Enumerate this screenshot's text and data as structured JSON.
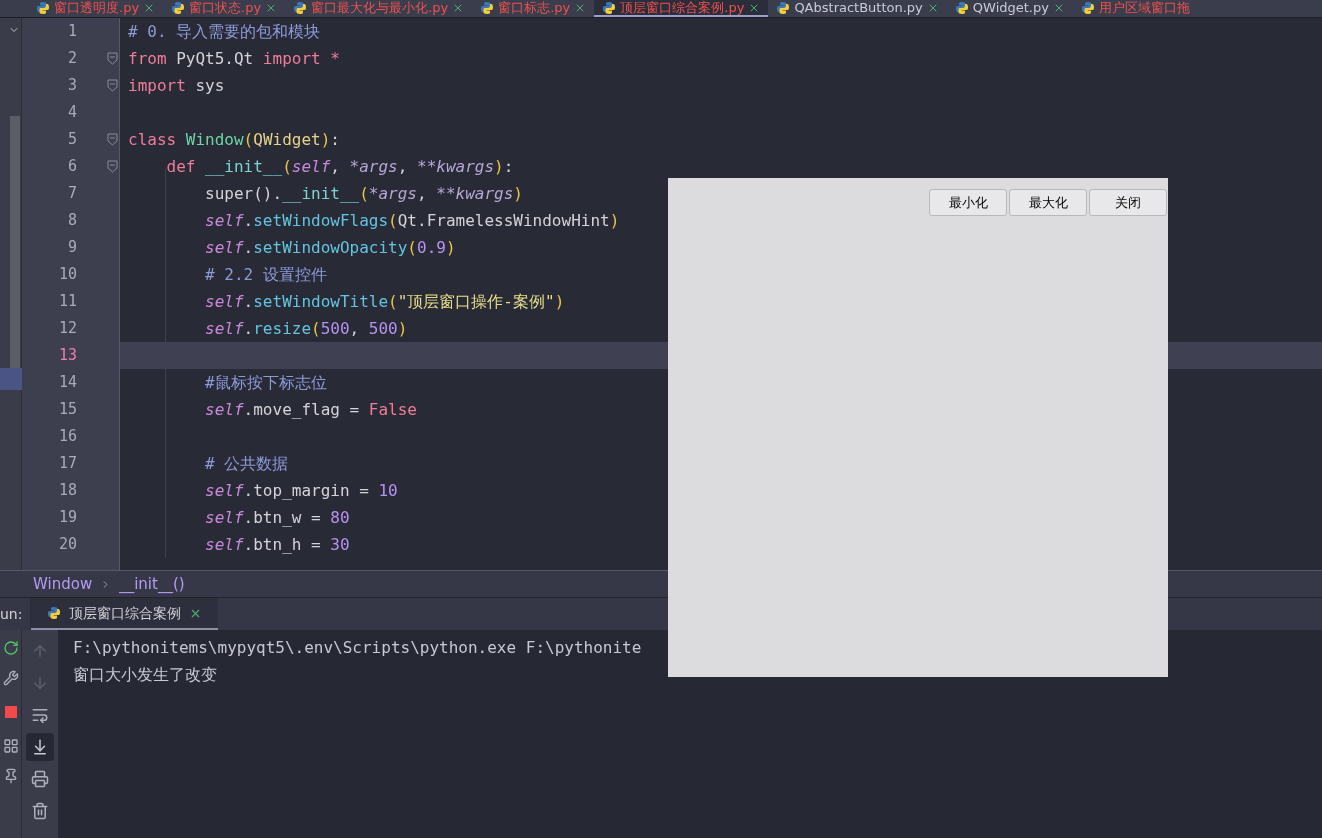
{
  "editor_tabs": [
    {
      "label": "窗口透明度.py",
      "selected": false
    },
    {
      "label": "窗口状态.py",
      "selected": false
    },
    {
      "label": "窗口最大化与最小化.py",
      "selected": false
    },
    {
      "label": "窗口标志.py",
      "selected": false
    },
    {
      "label": "顶层窗口综合案例.py",
      "selected": true
    },
    {
      "label": "QAbstractButton.py",
      "selected": false
    },
    {
      "label": "QWidget.py",
      "selected": false
    },
    {
      "label": "用户区域窗口拖",
      "selected": false
    }
  ],
  "code_lines": [
    {
      "number": "1",
      "current": false,
      "fold": false,
      "tokens": [
        {
          "kind": "comment",
          "text": "# 0. 导入需要的包和模块"
        }
      ]
    },
    {
      "number": "2",
      "current": false,
      "fold": true,
      "tokens": [
        {
          "kind": "keyword",
          "text": "from"
        },
        {
          "kind": "plain",
          "text": " PyQt5.Qt "
        },
        {
          "kind": "keyword",
          "text": "import"
        },
        {
          "kind": "keyword",
          "text": " *"
        }
      ]
    },
    {
      "number": "3",
      "current": false,
      "fold": true,
      "tokens": [
        {
          "kind": "keyword",
          "text": "import"
        },
        {
          "kind": "plain",
          "text": " sys"
        }
      ]
    },
    {
      "number": "4",
      "current": false,
      "fold": false
    },
    {
      "number": "5",
      "current": false,
      "fold": true,
      "tokens": [
        {
          "kind": "keyword",
          "text": "class"
        },
        {
          "kind": "classname",
          "text": " Window"
        },
        {
          "kind": "paren",
          "text": "("
        },
        {
          "kind": "builtin",
          "text": "QWidget"
        },
        {
          "kind": "paren",
          "text": ")"
        },
        {
          "kind": "plain",
          "text": ":"
        }
      ]
    },
    {
      "number": "6",
      "current": false,
      "fold": true,
      "tokens": [
        {
          "kind": "keyword",
          "text": "    def"
        },
        {
          "kind": "dunder",
          "text": " __init__"
        },
        {
          "kind": "paren",
          "text": "("
        },
        {
          "kind": "self",
          "text": "self"
        },
        {
          "kind": "plain",
          "text": ", "
        },
        {
          "kind": "param",
          "text": "*args"
        },
        {
          "kind": "plain",
          "text": ", "
        },
        {
          "kind": "param",
          "text": "**kwargs"
        },
        {
          "kind": "paren",
          "text": ")"
        },
        {
          "kind": "plain",
          "text": ":"
        }
      ]
    },
    {
      "number": "7",
      "current": false,
      "fold": false,
      "tokens": [
        {
          "kind": "plain",
          "text": "        super()."
        },
        {
          "kind": "dunder",
          "text": "__init__"
        },
        {
          "kind": "paren",
          "text": "("
        },
        {
          "kind": "param",
          "text": "*args"
        },
        {
          "kind": "plain",
          "text": ", "
        },
        {
          "kind": "param",
          "text": "**kwargs"
        },
        {
          "kind": "paren",
          "text": ")"
        }
      ]
    },
    {
      "number": "8",
      "current": false,
      "fold": false,
      "tokens": [
        {
          "kind": "self",
          "text": "        self"
        },
        {
          "kind": "plain",
          "text": "."
        },
        {
          "kind": "method",
          "text": "setWindowFlags"
        },
        {
          "kind": "paren",
          "text": "("
        },
        {
          "kind": "plain",
          "text": "Qt.FramelessWindowHint"
        },
        {
          "kind": "paren",
          "text": ")"
        }
      ]
    },
    {
      "number": "9",
      "current": false,
      "fold": false,
      "tokens": [
        {
          "kind": "self",
          "text": "        self"
        },
        {
          "kind": "plain",
          "text": "."
        },
        {
          "kind": "method",
          "text": "setWindowOpacity"
        },
        {
          "kind": "paren",
          "text": "("
        },
        {
          "kind": "number",
          "text": "0.9"
        },
        {
          "kind": "paren",
          "text": ")"
        }
      ]
    },
    {
      "number": "10",
      "current": false,
      "fold": false,
      "tokens": [
        {
          "kind": "comment",
          "text": "        # 2.2 设置控件"
        }
      ]
    },
    {
      "number": "11",
      "current": false,
      "fold": false,
      "tokens": [
        {
          "kind": "self",
          "text": "        self"
        },
        {
          "kind": "plain",
          "text": "."
        },
        {
          "kind": "method",
          "text": "setWindowTitle"
        },
        {
          "kind": "paren",
          "text": "("
        },
        {
          "kind": "string",
          "text": "\"顶层窗口操作-案例\""
        },
        {
          "kind": "paren",
          "text": ")"
        }
      ]
    },
    {
      "number": "12",
      "current": false,
      "fold": false,
      "tokens": [
        {
          "kind": "self",
          "text": "        self"
        },
        {
          "kind": "plain",
          "text": "."
        },
        {
          "kind": "method",
          "text": "resize"
        },
        {
          "kind": "paren",
          "text": "("
        },
        {
          "kind": "number",
          "text": "500"
        },
        {
          "kind": "plain",
          "text": ", "
        },
        {
          "kind": "number",
          "text": "500"
        },
        {
          "kind": "paren",
          "text": ")"
        }
      ]
    },
    {
      "number": "13",
      "current": true,
      "fold": false
    },
    {
      "number": "14",
      "current": false,
      "fold": false,
      "tokens": [
        {
          "kind": "comment",
          "text": "        #鼠标按下标志位"
        }
      ]
    },
    {
      "number": "15",
      "current": false,
      "fold": false,
      "tokens": [
        {
          "kind": "self",
          "text": "        self"
        },
        {
          "kind": "plain",
          "text": ".move_flag = "
        },
        {
          "kind": "keyword",
          "text": "False"
        }
      ]
    },
    {
      "number": "16",
      "current": false,
      "fold": false
    },
    {
      "number": "17",
      "current": false,
      "fold": false,
      "tokens": [
        {
          "kind": "comment",
          "text": "        # 公共数据"
        }
      ]
    },
    {
      "number": "18",
      "current": false,
      "fold": false,
      "tokens": [
        {
          "kind": "self",
          "text": "        self"
        },
        {
          "kind": "plain",
          "text": ".top_margin = "
        },
        {
          "kind": "number",
          "text": "10"
        }
      ]
    },
    {
      "number": "19",
      "current": false,
      "fold": false,
      "tokens": [
        {
          "kind": "self",
          "text": "        self"
        },
        {
          "kind": "plain",
          "text": ".btn_w = "
        },
        {
          "kind": "number",
          "text": "80"
        }
      ]
    },
    {
      "number": "20",
      "current": false,
      "fold": false,
      "tokens": [
        {
          "kind": "self",
          "text": "        self"
        },
        {
          "kind": "plain",
          "text": ".btn_h = "
        },
        {
          "kind": "number",
          "text": "30"
        }
      ]
    }
  ],
  "breadcrumb": [
    "Window",
    "__init__()"
  ],
  "run_panel": {
    "label": "un:",
    "tabs": [
      {
        "label": "顶层窗口综合案例",
        "selected": true
      }
    ],
    "console": [
      "F:\\pythonitems\\mypyqt5\\.env\\Scripts\\python.exe F:\\pythonite",
      "窗口大小发生了改变"
    ]
  },
  "floating_window": {
    "buttons": [
      "最小化",
      "最大化",
      "关闭"
    ]
  }
}
